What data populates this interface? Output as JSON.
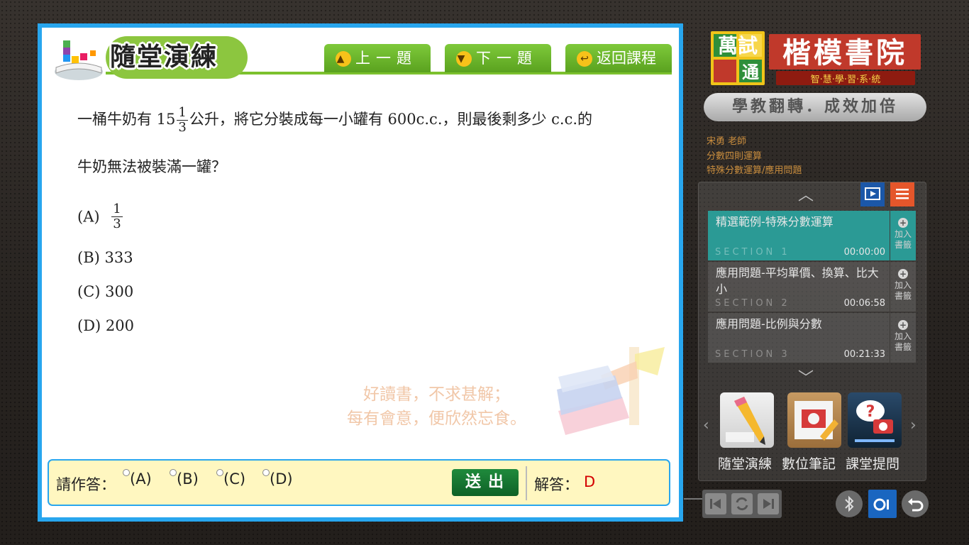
{
  "header": {
    "title": "隨堂演練",
    "prev_label": "上一題",
    "next_label": "下一題",
    "back_label": "返回課程"
  },
  "question": {
    "text_before": "一桶牛奶有 15",
    "frac_num": "1",
    "frac_den": "3",
    "text_after": "公升，將它分裝成每一小罐有  600c.c.，則最後剩多少 c.c.的",
    "line2": "牛奶無法被裝滿一罐？"
  },
  "options": {
    "a_label": "(A)",
    "a_num": "1",
    "a_den": "3",
    "b": "(B) 333",
    "c": "(C) 300",
    "d": "(D) 200"
  },
  "watermark": {
    "line1": "好讀書，不求甚解；",
    "line2": "每有會意，便欣然忘食。"
  },
  "answer_bar": {
    "prompt": "請作答：",
    "choice_a": "(A)",
    "choice_b": "(B)",
    "choice_c": "(C)",
    "choice_d": "(D)",
    "submit": "送出",
    "answer_label": "解答：",
    "answer_value": "D"
  },
  "brand": {
    "logo_left_top": "萬試",
    "logo_left_bottom": "通",
    "logo_name": "楷模書院",
    "logo_sub": "智·慧·學·習·系·統",
    "slogan": "學教翻轉．成效加倍"
  },
  "info": {
    "teacher": "宋勇  老師",
    "unit": "分數四則運算",
    "topic": "特殊分數運算/應用問題"
  },
  "sections": [
    {
      "title": "精選範例-特殊分數運算",
      "label": "SECTION 1",
      "time": "00:00:00",
      "bookmark": "加入書籤"
    },
    {
      "title": "應用問題-平均單價、換算、比大小",
      "label": "SECTION 2",
      "time": "00:06:58",
      "bookmark": "加入書籤"
    },
    {
      "title": "應用問題-比例與分數",
      "label": "SECTION 3",
      "time": "00:21:33",
      "bookmark": "加入書籤"
    }
  ],
  "tools": {
    "practice": "隨堂演練",
    "notes": "數位筆記",
    "ask": "課堂提問"
  },
  "colors": {
    "frame_blue": "#28a6ee",
    "header_green": "#7cc12e",
    "active_section": "#2b9a95",
    "answer_red": "#d40000",
    "answer_bg": "#fff7c0"
  }
}
